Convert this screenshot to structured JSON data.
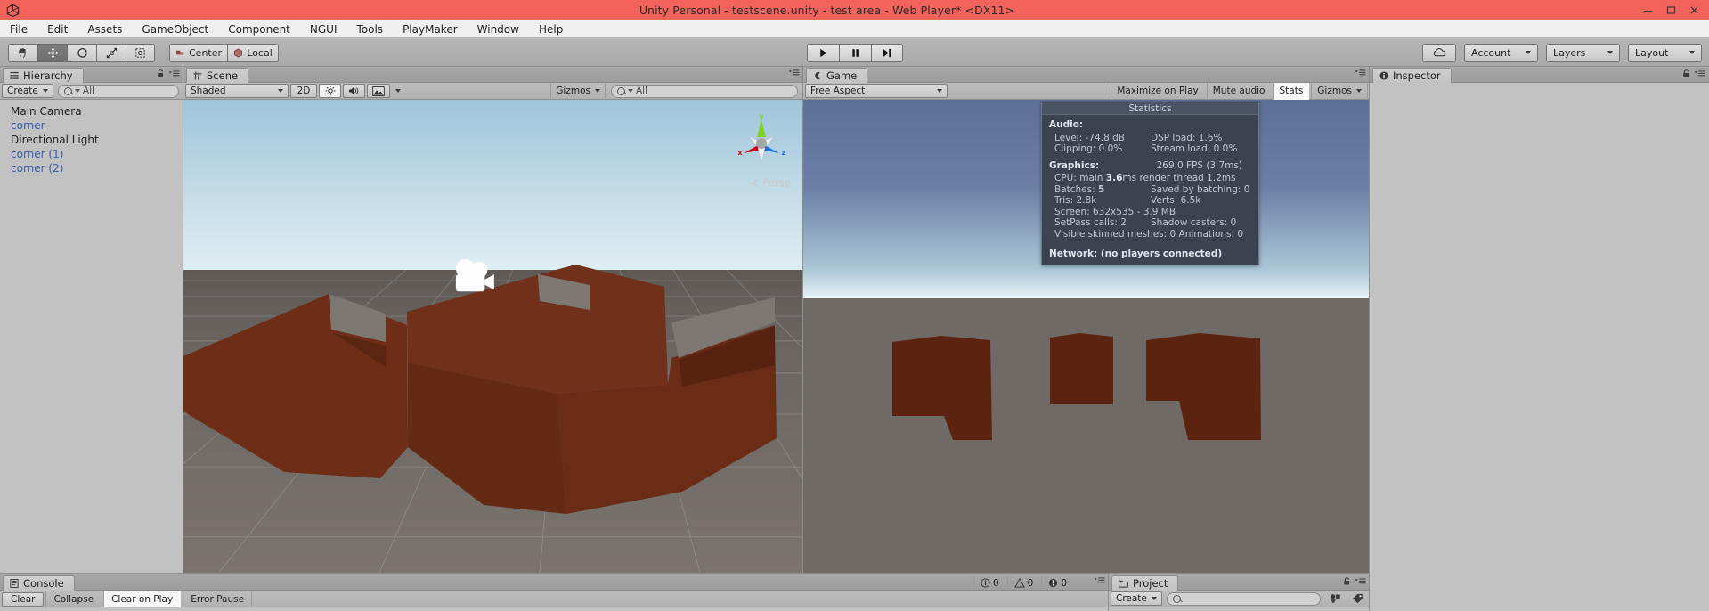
{
  "window": {
    "title": "Unity Personal - testscene.unity - test area - Web Player* <DX11>",
    "logo_icon": "unity-logo-icon",
    "minimize_icon": "minimize-icon",
    "maximize_icon": "maximize-icon",
    "close_icon": "close-icon"
  },
  "menubar": {
    "items": [
      {
        "label": "File"
      },
      {
        "label": "Edit"
      },
      {
        "label": "Assets"
      },
      {
        "label": "GameObject"
      },
      {
        "label": "Component"
      },
      {
        "label": "NGUI"
      },
      {
        "label": "Tools"
      },
      {
        "label": "PlayMaker"
      },
      {
        "label": "Window"
      },
      {
        "label": "Help"
      }
    ]
  },
  "toolbar": {
    "tools": [
      {
        "name": "hand-tool",
        "icon": "hand-icon",
        "selected": false
      },
      {
        "name": "move-tool",
        "icon": "move-arrows-icon",
        "selected": true
      },
      {
        "name": "rotate-tool",
        "icon": "rotate-icon",
        "selected": false
      },
      {
        "name": "scale-tool",
        "icon": "scale-icon",
        "selected": false
      },
      {
        "name": "rect-tool",
        "icon": "rect-transform-icon",
        "selected": false
      }
    ],
    "pivot_label": "Center",
    "pivot_icon": "pivot-center-icon",
    "space_label": "Local",
    "space_icon": "local-space-icon",
    "play_label": "Play",
    "pause_label": "Pause",
    "step_label": "Step",
    "cloud_icon": "cloud-icon",
    "account_label": "Account",
    "layers_label": "Layers",
    "layout_label": "Layout"
  },
  "hierarchy": {
    "tab_label": "Hierarchy",
    "tab_icon": "hierarchy-icon",
    "lock_icon": "lock-icon",
    "menu_icon": "panel-menu-icon",
    "create_label": "Create",
    "search_placeholder": "All",
    "search_value": "",
    "items": [
      {
        "label": "Main Camera",
        "prefab": false
      },
      {
        "label": "corner",
        "prefab": true
      },
      {
        "label": "Directional Light",
        "prefab": false
      },
      {
        "label": "corner (1)",
        "prefab": true
      },
      {
        "label": "corner (2)",
        "prefab": true
      }
    ]
  },
  "scene": {
    "tab_label": "Scene",
    "tab_icon": "scene-grid-icon",
    "draw_mode": "Shaded",
    "two_d_label": "2D",
    "lighting_icon": "sun-icon",
    "audio_icon": "speaker-icon",
    "effects_icon": "image-effects-icon",
    "gizmos_label": "Gizmos",
    "search_placeholder": "All",
    "search_value": "",
    "menu_icon": "panel-menu-icon",
    "projection_label": "Persp",
    "axis_x": "x",
    "axis_y": "y",
    "axis_z": "z",
    "camera_gizmo_icon": "camera-icon"
  },
  "game": {
    "tab_label": "Game",
    "tab_icon": "game-icon",
    "aspect_label": "Free Aspect",
    "maximize_label": "Maximize on Play",
    "mute_label": "Mute audio",
    "stats_label": "Stats",
    "stats_active": true,
    "gizmos_label": "Gizmos",
    "menu_icon": "panel-menu-icon"
  },
  "statistics": {
    "title": "Statistics",
    "audio_heading": "Audio:",
    "audio_rows": [
      {
        "left": "Level: -74.8 dB",
        "right": "DSP load: 1.6%"
      },
      {
        "left": "Clipping: 0.0%",
        "right": "Stream load: 0.0%"
      }
    ],
    "graphics_heading": "Graphics:",
    "fps": "269.0 FPS (3.7ms)",
    "cpu_prefix": "CPU: main ",
    "cpu_main": "3.6",
    "cpu_suffix": "ms  render thread 1.2ms",
    "batches_prefix": "Batches: ",
    "batches_value": "5",
    "saved_by_batching": "Saved by batching: 0",
    "tris": "Tris: 2.8k",
    "verts": "Verts: 6.5k",
    "screen": "Screen: 632x535 - 3.9 MB",
    "setpass": "SetPass calls: 2",
    "shadow_casters": "Shadow casters: 0",
    "skinned_meshes": "Visible skinned meshes: 0  Animations: 0",
    "network": "Network: (no players connected)"
  },
  "inspector": {
    "tab_label": "Inspector",
    "tab_icon": "info-icon",
    "lock_icon": "lock-icon",
    "menu_icon": "panel-menu-icon"
  },
  "console": {
    "tab_label": "Console",
    "tab_icon": "console-icon",
    "clear_label": "Clear",
    "collapse_label": "Collapse",
    "clear_on_play_label": "Clear on Play",
    "error_pause_label": "Error Pause",
    "menu_icon": "panel-menu-icon",
    "counts": [
      {
        "icon": "info-count-icon",
        "value": "0"
      },
      {
        "icon": "warning-count-icon",
        "value": "0"
      },
      {
        "icon": "error-count-icon",
        "value": "0"
      }
    ]
  },
  "project": {
    "tab_label": "Project",
    "tab_icon": "folder-icon",
    "lock_icon": "lock-icon",
    "menu_icon": "panel-menu-icon",
    "create_label": "Create",
    "search_placeholder": "",
    "search_value": "",
    "filter_type_icon": "filter-by-type-icon",
    "filter_label_icon": "filter-by-label-icon"
  },
  "colors": {
    "title_bar": "#f4625c",
    "chrome": "#c2c2c2",
    "geometry": "#5c2410",
    "ground": "#6f6a65",
    "stats_bg": "#3b4350",
    "prefab_blue": "#3b5fa8"
  }
}
